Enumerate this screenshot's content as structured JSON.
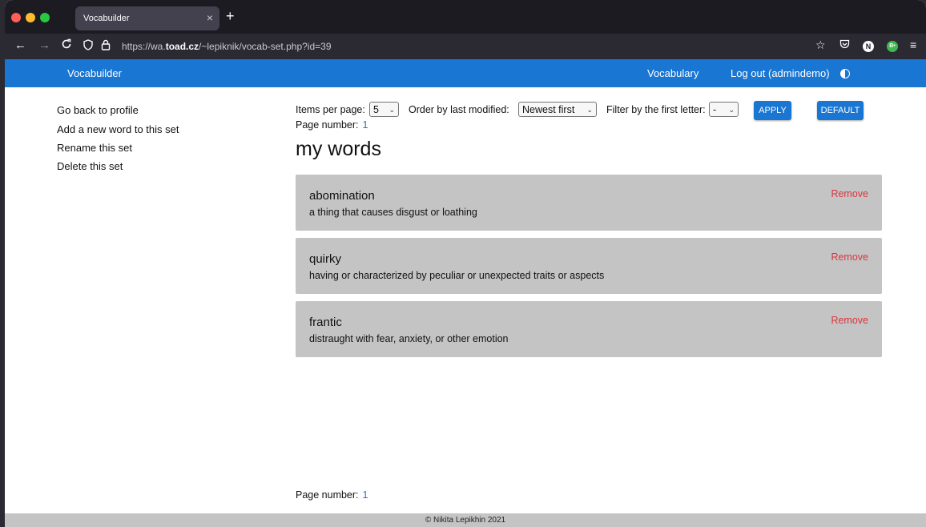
{
  "browser": {
    "tab_title": "Vocabuilder",
    "tab_close": "×",
    "new_tab": "+",
    "url_prefix": "https://wa.",
    "url_domain": "toad.cz",
    "url_path": "/~lepiknik/vocab-set.php?id=39",
    "icons": [
      "back-icon",
      "forward-icon",
      "reload-icon",
      "shield-icon",
      "lock-icon",
      "star-icon",
      "pocket-icon",
      "n-extension-icon",
      "b-extension-icon",
      "menu-icon"
    ],
    "ext_n": "N",
    "ext_b": "B•"
  },
  "header": {
    "brand": "Vocabuilder",
    "vocabulary": "Vocabulary",
    "logout": "Log out (admindemo)",
    "accent": "#1976d2"
  },
  "sidebar": {
    "items": [
      {
        "label": "Go back to profile"
      },
      {
        "label": "Add a new word to this set"
      },
      {
        "label": "Rename this set"
      },
      {
        "label": "Delete this set"
      }
    ]
  },
  "filters": {
    "items_label": "Items per page:",
    "items_value": "5",
    "order_label": "Order by last modified:",
    "order_value": "Newest first",
    "letter_label": "Filter by the first letter:",
    "letter_value": "-",
    "apply": "APPLY",
    "default": "DEFAULT"
  },
  "pagination": {
    "label": "Page number:",
    "current": "1"
  },
  "set": {
    "title": "my words",
    "remove_label": "Remove",
    "words": [
      {
        "word": "abomination",
        "definition": "a thing that causes disgust or loathing"
      },
      {
        "word": "quirky",
        "definition": "having or characterized by peculiar or unexpected traits or aspects"
      },
      {
        "word": "frantic",
        "definition": "distraught with fear, anxiety, or other emotion"
      }
    ]
  },
  "footer": {
    "text": "© Nikita Lepikhin 2021"
  }
}
